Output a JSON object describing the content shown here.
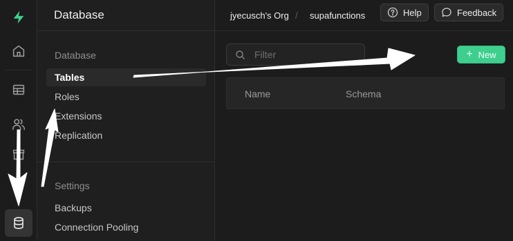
{
  "rail": {
    "items": [
      {
        "name": "logo",
        "icon": "supabase-logo-icon"
      },
      {
        "name": "home",
        "icon": "home-icon"
      },
      {
        "name": "table-editor",
        "icon": "table-icon"
      },
      {
        "name": "auth",
        "icon": "users-icon"
      },
      {
        "name": "storage",
        "icon": "archive-icon"
      },
      {
        "name": "database",
        "icon": "database-icon",
        "active": true
      }
    ]
  },
  "menu": {
    "title": "Database",
    "sections": [
      {
        "title": "Database",
        "items": [
          {
            "label": "Tables",
            "active": true
          },
          {
            "label": "Roles"
          },
          {
            "label": "Extensions"
          },
          {
            "label": "Replication"
          }
        ]
      },
      {
        "title": "Settings",
        "items": [
          {
            "label": "Backups"
          },
          {
            "label": "Connection Pooling"
          }
        ]
      }
    ]
  },
  "topbar": {
    "org": "jyecusch's Org",
    "separator": "/",
    "project": "supafunctions",
    "help_label": "Help",
    "feedback_label": "Feedback"
  },
  "main": {
    "filter_placeholder": "Filter",
    "new_label": "New",
    "table_headers": [
      "Name",
      "Schema"
    ]
  },
  "colors": {
    "accent": "#3ecf8e",
    "background": "#1c1c1c",
    "arrow": "#ffffff"
  }
}
